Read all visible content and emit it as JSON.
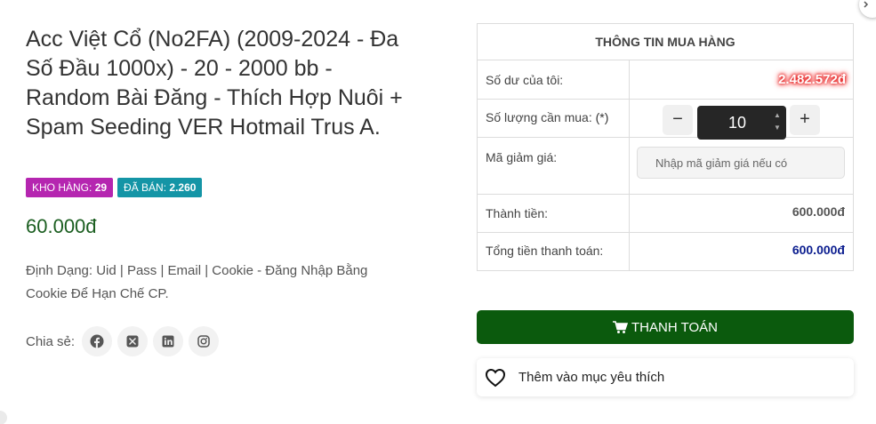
{
  "product": {
    "title": "Acc Việt Cổ (No2FA) (2009-2024 - Đa Số Đầu 1000x) - 20 - 2000 bb - Random Bài Đăng - Thích Hợp Nuôi + Spam Seeding VER Hotmail Trus A.",
    "stock_label": "KHO HÀNG:",
    "stock_value": "29",
    "sold_label": "ĐÃ BÁN:",
    "sold_value": "2.260",
    "price": "60.000đ",
    "description": "Định Dạng: Uid | Pass | Email | Cookie - Đăng Nhập Bằng Cookie Để Hạn Chế CP.",
    "share_label": "Chia sẻ:",
    "share_icons": [
      "facebook-icon",
      "x-icon",
      "linkedin-icon",
      "instagram-icon"
    ]
  },
  "purchase": {
    "header": "THÔNG TIN MUA HÀNG",
    "balance_label": "Số dư của tôi:",
    "balance_value": "2.482.572đ",
    "quantity_label": "Số lượng cần mua:",
    "quantity_required": "(*)",
    "quantity_value": "10",
    "minus_label": "−",
    "plus_label": "+",
    "coupon_label": "Mã giảm giá:",
    "coupon_placeholder": "Nhập mã giảm giá nếu có",
    "subtotal_label": "Thành tiền:",
    "subtotal_value": "600.000đ",
    "total_label": "Tổng tiền thanh toán:",
    "total_value": "600.000đ"
  },
  "actions": {
    "pay_label": "THANH TOÁN",
    "wishlist_label": "Thêm vào mục yêu thích"
  },
  "colors": {
    "stock_badge": "#b526b0",
    "sold_badge": "#1495a6",
    "price": "#1b5e20",
    "pay_button": "#0b5a0d",
    "total": "#0b1d8f",
    "balance_glow": "#e00000"
  }
}
